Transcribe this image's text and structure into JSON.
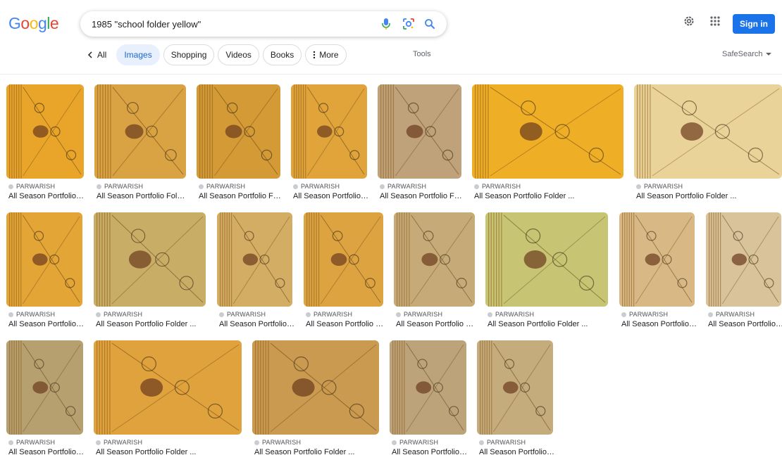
{
  "logo": [
    "G",
    "o",
    "o",
    "g",
    "l",
    "e"
  ],
  "logo_colors": [
    "#4285f4",
    "#ea4335",
    "#fbbc05",
    "#4285f4",
    "#34a853",
    "#ea4335"
  ],
  "search": {
    "query": "1985 \"school folder yellow\""
  },
  "header": {
    "signin_label": "Sign in",
    "tools_label": "Tools",
    "safesearch_label": "SafeSearch"
  },
  "tabs": {
    "back_label": "All",
    "items": [
      "Images",
      "Shopping",
      "Videos",
      "Books",
      "More"
    ],
    "active": "Images"
  },
  "accent_color": "#1a73e8",
  "results": [
    {
      "source": "PARWARISH",
      "title": "All Season Portfolio Folder ...",
      "bg": "#e8a52a"
    },
    {
      "source": "PARWARISH",
      "title": "All Season Portfolio Folder ...",
      "bg": "#d9a242"
    },
    {
      "source": "PARWARISH",
      "title": "All Season Portfolio Folder ...",
      "bg": "#d39a36"
    },
    {
      "source": "PARWARISH",
      "title": "All Season Portfolio Folder ...",
      "bg": "#e0a43a"
    },
    {
      "source": "PARWARISH",
      "title": "All Season Portfolio Folder ...",
      "bg": "#bfa279"
    },
    {
      "source": "PARWARISH",
      "title": "All Season Portfolio Folder ...",
      "bg": "#eeae26"
    },
    {
      "source": "PARWARISH",
      "title": "All Season Portfolio Folder ...",
      "bg": "#ead398"
    },
    {
      "source": "PARWARISH",
      "title": "All Season Portfolio Folder ...",
      "bg": "#e3a536"
    },
    {
      "source": "PARWARISH",
      "title": "All Season Portfolio Folder ...",
      "bg": "#c8ad66"
    },
    {
      "source": "PARWARISH",
      "title": "All Season Portfolio Folder ...",
      "bg": "#d3ad64"
    },
    {
      "source": "PARWARISH",
      "title": "All Season Portfolio Folder ...",
      "bg": "#dca340"
    },
    {
      "source": "PARWARISH",
      "title": "All Season Portfolio Folder ...",
      "bg": "#c6ab78"
    },
    {
      "source": "PARWARISH",
      "title": "All Season Portfolio Folder ...",
      "bg": "#c7c573"
    },
    {
      "source": "PARWARISH",
      "title": "All Season Portfolio Folder ...",
      "bg": "#d8b985"
    },
    {
      "source": "PARWARISH",
      "title": "All Season Portfolio Folder ...",
      "bg": "#d8c39a"
    },
    {
      "source": "PARWARISH",
      "title": "All Season Portfolio Folder ...",
      "bg": "#b7a06f"
    },
    {
      "source": "PARWARISH",
      "title": "All Season Portfolio Folder ...",
      "bg": "#e0a23c"
    },
    {
      "source": "PARWARISH",
      "title": "All Season Portfolio Folder ...",
      "bg": "#c99a4f"
    },
    {
      "source": "PARWARISH",
      "title": "All Season Portfolio Folder ...",
      "bg": "#bca37a"
    },
    {
      "source": "PARWARISH",
      "title": "All Season Portfolio Folder ...",
      "bg": "#c5ac7c"
    }
  ]
}
